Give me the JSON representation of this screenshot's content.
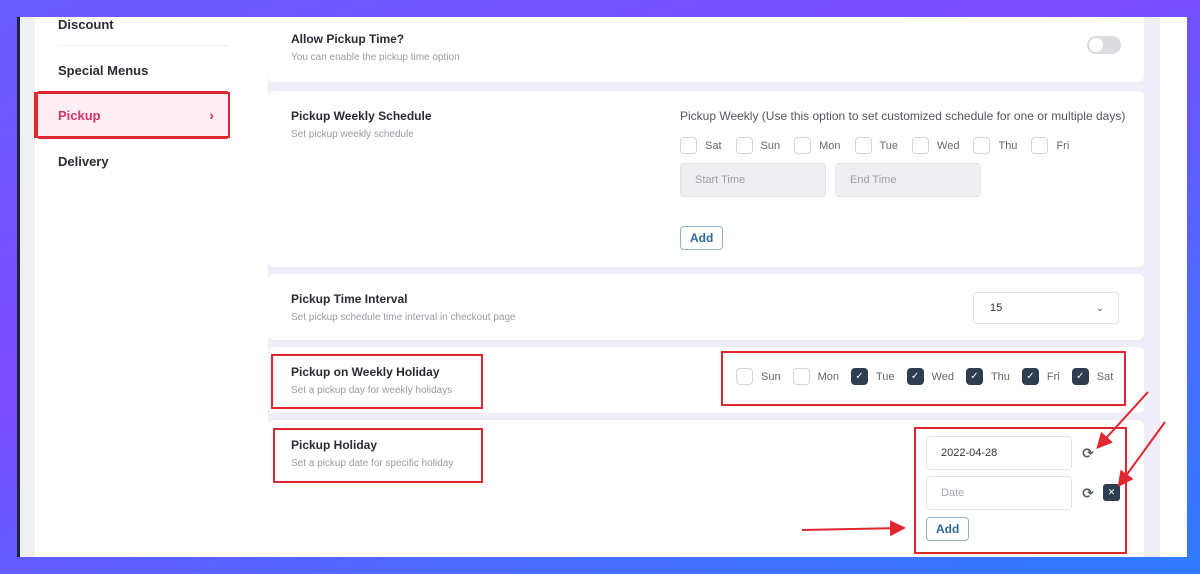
{
  "sidebar": {
    "items": [
      {
        "label": "Discount",
        "active": false
      },
      {
        "label": "Special Menus",
        "active": false
      },
      {
        "label": "Pickup",
        "active": true
      },
      {
        "label": "Delivery",
        "active": false
      }
    ],
    "active_chevron": "›"
  },
  "allow_pickup_time": {
    "title": "Allow Pickup Time?",
    "description": "You can enable the pickup time option",
    "enabled": false
  },
  "weekly_schedule": {
    "title": "Pickup Weekly Schedule",
    "description": "Set pickup weekly schedule",
    "option_label": "Pickup Weekly (Use this option to set customized schedule for one or multiple days)",
    "days": [
      {
        "label": "Sat",
        "checked": false
      },
      {
        "label": "Sun",
        "checked": false
      },
      {
        "label": "Mon",
        "checked": false
      },
      {
        "label": "Tue",
        "checked": false
      },
      {
        "label": "Wed",
        "checked": false
      },
      {
        "label": "Thu",
        "checked": false
      },
      {
        "label": "Fri",
        "checked": false
      }
    ],
    "start_time_placeholder": "Start Time",
    "end_time_placeholder": "End Time",
    "add_label": "Add"
  },
  "time_interval": {
    "title": "Pickup Time Interval",
    "description": "Set pickup schedule time interval in checkout page",
    "selected": "15"
  },
  "weekly_holiday": {
    "title": "Pickup on Weekly Holiday",
    "description": "Set a pickup day for weekly holidays",
    "days": [
      {
        "label": "Sun",
        "checked": false
      },
      {
        "label": "Mon",
        "checked": false
      },
      {
        "label": "Tue",
        "checked": true
      },
      {
        "label": "Wed",
        "checked": true
      },
      {
        "label": "Thu",
        "checked": true
      },
      {
        "label": "Fri",
        "checked": true
      },
      {
        "label": "Sat",
        "checked": true
      }
    ]
  },
  "pickup_holiday": {
    "title": "Pickup Holiday",
    "description": "Set a pickup date for specific holiday",
    "dates": [
      {
        "value": "2022-04-28",
        "placeholder": "Date"
      },
      {
        "value": "",
        "placeholder": "Date"
      }
    ],
    "add_label": "Add"
  },
  "icons": {
    "check": "✓",
    "refresh": "⟳",
    "close": "✕",
    "chevron_down": "⌄"
  },
  "colors": {
    "active_pink": "#d6336c",
    "highlight_red": "#e0262e",
    "checkbox_dark": "#2e3d4f",
    "add_blue": "#2a6a97"
  }
}
